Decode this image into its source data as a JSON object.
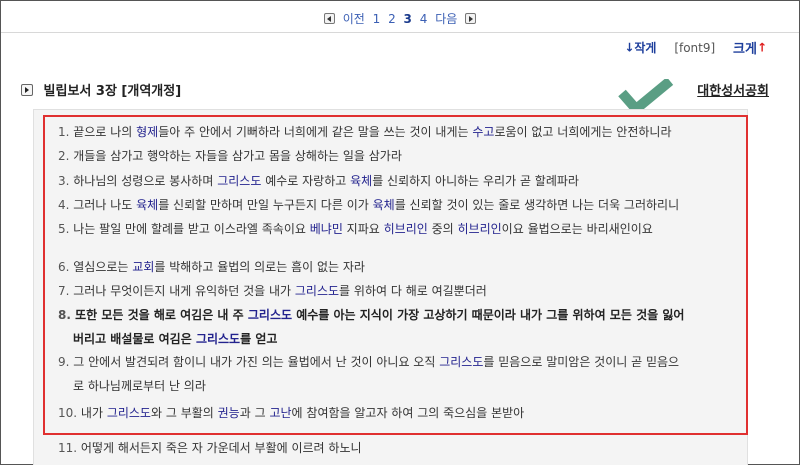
{
  "pager": {
    "prev_label": "이전",
    "pages": [
      "1",
      "2",
      "3",
      "4"
    ],
    "current_page": "3",
    "next_label": "다음"
  },
  "font_controls": {
    "smaller_label": "작게",
    "font_name": "[font9]",
    "larger_label": "크게"
  },
  "title": "빌립보서 3장 [개역개정]",
  "publisher": "대한성서공회",
  "verses": [
    {
      "num": "1.",
      "text": [
        {
          "t": "끝으로 나의 "
        },
        {
          "t": "형제",
          "hl": true
        },
        {
          "t": "들아 주 안에서 기뻐하라 너희에게 같은 말을 쓰는 것이 내게는 "
        },
        {
          "t": "수고",
          "hl": true
        },
        {
          "t": "로움이 없고 너희에게는 안전하니라"
        }
      ]
    },
    {
      "num": "2.",
      "text": [
        {
          "t": "개들을 삼가고 행악하는 자들을 삼가고 몸을 상해하는 일을 삼가라"
        }
      ]
    },
    {
      "num": "3.",
      "text": [
        {
          "t": "하나님의 성령으로 봉사하며 "
        },
        {
          "t": "그리스도",
          "hl": true
        },
        {
          "t": " 예수로 자랑하고 "
        },
        {
          "t": "육체",
          "hl": true
        },
        {
          "t": "를 신뢰하지 아니하는 우리가 곧 할례파라"
        }
      ]
    },
    {
      "num": "4.",
      "text": [
        {
          "t": "그러나 나도 "
        },
        {
          "t": "육체",
          "hl": true
        },
        {
          "t": "를 신뢰할 만하며 만일 누구든지 다른 이가 "
        },
        {
          "t": "육체",
          "hl": true
        },
        {
          "t": "를 신뢰할 것이 있는 줄로 생각하면 나는 더욱 그러하리니"
        }
      ]
    },
    {
      "num": "5.",
      "text": [
        {
          "t": "나는 팔일 만에 할례를 받고 이스라엘 족속이요 "
        },
        {
          "t": "베냐민",
          "hl": true
        },
        {
          "t": " 지파요 "
        },
        {
          "t": "히브리인",
          "hl": true
        },
        {
          "t": " 중의 "
        },
        {
          "t": "히브리인",
          "hl": true
        },
        {
          "t": "이요 율법으로는 바리새인이요"
        }
      ]
    },
    {
      "num": "6.",
      "text": [
        {
          "t": "열심으로는 "
        },
        {
          "t": "교회",
          "hl": true
        },
        {
          "t": "를 박해하고 율법의 의로는 흠이 없는 자라"
        }
      ]
    },
    {
      "num": "7.",
      "text": [
        {
          "t": "그러나 무엇이든지 내게 유익하던 것을 내가 "
        },
        {
          "t": "그리스도",
          "hl": true
        },
        {
          "t": "를 위하여 다 해로 여길뿐더러"
        }
      ]
    },
    {
      "num": "8.",
      "bold": true,
      "text": [
        {
          "t": "또한 모든 것을 해로 여김은 내 주 "
        },
        {
          "t": "그리스도",
          "hl": true
        },
        {
          "t": " 예수를 아는 지식이 가장 고상하기 때문이라 내가 그를 위하여 모든 것을 잃어"
        }
      ],
      "cont": [
        {
          "t": "버리고 배설물로 여김은 "
        },
        {
          "t": "그리스도",
          "hl": true
        },
        {
          "t": "를 얻고"
        }
      ]
    },
    {
      "num": "9.",
      "text": [
        {
          "t": "그 안에서 발견되려 함이니 내가 가진 의는 율법에서 난 것이 아니요 오직 "
        },
        {
          "t": "그리스도",
          "hl": true
        },
        {
          "t": "를 믿음으로 말미암은 것이니 곧 믿음으"
        }
      ],
      "cont": [
        {
          "t": "로 하나님께로부터 난 의라"
        }
      ]
    },
    {
      "num": "10.",
      "text": [
        {
          "t": "내가 "
        },
        {
          "t": "그리스도",
          "hl": true
        },
        {
          "t": "와 그 부활의 "
        },
        {
          "t": "권능",
          "hl": true
        },
        {
          "t": "과 그 "
        },
        {
          "t": "고난",
          "hl": true
        },
        {
          "t": "에 참여함을 알고자 하여 그의 죽으심을 본받아"
        }
      ]
    },
    {
      "num": "11.",
      "text": [
        {
          "t": "어떻게 해서든지 죽은 자 가운데서 부활에 이르려 하노니"
        }
      ]
    }
  ],
  "colors": {
    "highlight_text": "#23238e",
    "annotation_box": "#e03030",
    "checkmark": "#5a9e84",
    "link": "#3b5fb4"
  },
  "icons": [
    "prev-page-icon",
    "next-page-icon",
    "arrow-down-icon",
    "arrow-up-icon",
    "play-triangle-icon",
    "checkmark-icon"
  ]
}
